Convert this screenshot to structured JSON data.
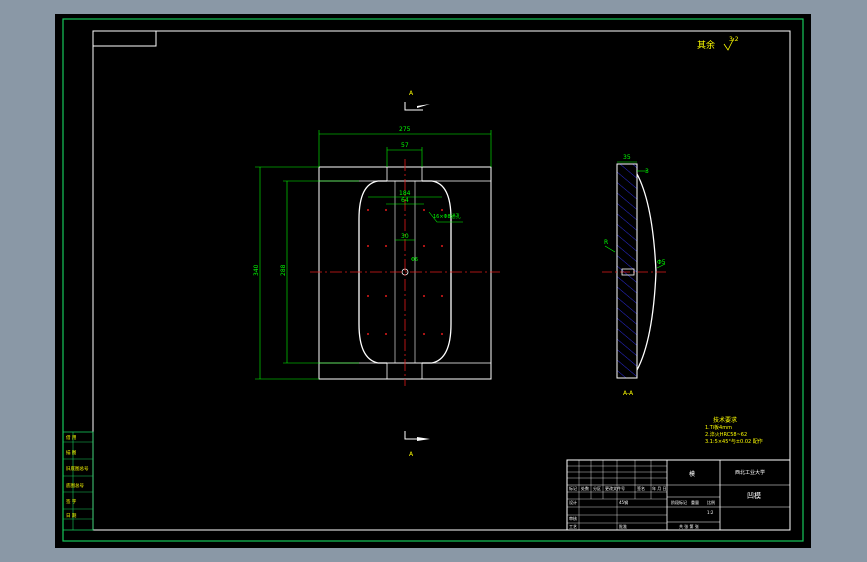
{
  "colors": {
    "background": "#000000",
    "viewer": "#8a98a6",
    "frame": "#16c85a",
    "part": "#ffffff",
    "centerline": "#e01a1a",
    "dimension": "#00ff00",
    "hatch": "#2b2bd6",
    "text": "#ffff00"
  },
  "drawing": {
    "roughness_note": "其余",
    "roughness_value": "3.2",
    "section_mark_top": "A",
    "section_mark_bottom": "A",
    "section_label": "A-A",
    "dims": {
      "overall_width": "275",
      "slot_width": "57",
      "overall_height": "340",
      "cavity_height": "288",
      "inner_width_1": "184",
      "inner_width_2": "64",
      "hole_note": "16×Φ8通孔",
      "center_hole": "Φ6",
      "side_width": "35",
      "side_step": "3",
      "side_angle": "R",
      "side_small": "Φ5",
      "center_small": "30"
    },
    "tech_requirements": {
      "title": "技术要求",
      "lines": [
        "1.Ti板4mm",
        "2.淬火HRC58~62",
        "3.1:5×45°与±0.02 配作"
      ]
    },
    "left_strip": [
      "借 用",
      "描 图",
      "旧底图总号",
      "底图总号",
      "签 字",
      "日 期"
    ],
    "title_block": {
      "part_name": "模",
      "company": "西北工业大学",
      "drawing_no": "凹模",
      "row_labels": [
        "标记",
        "处数",
        "分区",
        "更改文件号",
        "签名",
        "年 月 日"
      ],
      "stage_labels": [
        "阶段标记",
        "重量",
        "比例"
      ],
      "scale": "1:2",
      "sheet_info": "共 张 第 张",
      "designer": "设计",
      "checker": "审核",
      "craft": "工艺",
      "approve": "批准",
      "material": "45钢"
    }
  }
}
